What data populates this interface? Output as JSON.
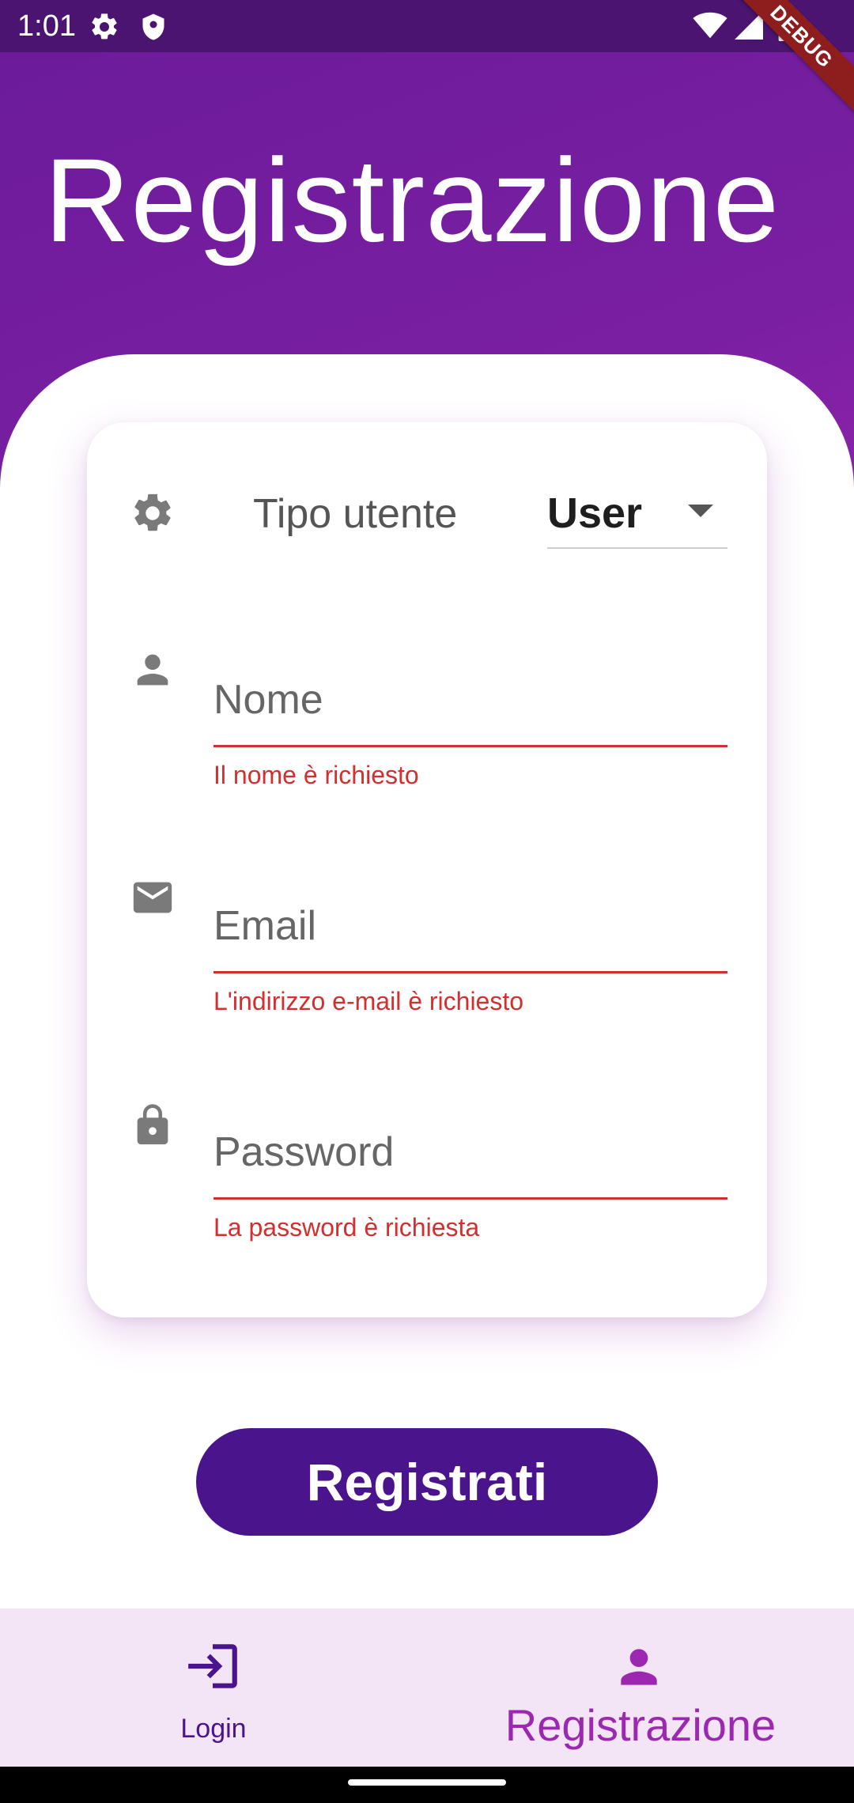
{
  "status_bar": {
    "time": "1:01",
    "icons": [
      "gear-icon",
      "shield-icon",
      "wifi-icon",
      "signal-icon",
      "battery-icon"
    ]
  },
  "debug_banner": "DEBUG",
  "page": {
    "title": "Registrazione"
  },
  "form": {
    "user_type": {
      "label": "Tipo utente",
      "selected": "User",
      "icon": "gear-icon"
    },
    "name": {
      "placeholder": "Nome",
      "value": "",
      "error": "Il nome è richiesto",
      "icon": "person-icon"
    },
    "email": {
      "placeholder": "Email",
      "value": "",
      "error": "L'indirizzo e-mail è richiesto",
      "icon": "mail-icon"
    },
    "password": {
      "placeholder": "Password",
      "value": "",
      "error": "La password è richiesta",
      "icon": "lock-icon"
    }
  },
  "actions": {
    "register_label": "Registrati"
  },
  "bottom_nav": {
    "items": [
      {
        "label": "Login",
        "icon": "login-icon",
        "active": false
      },
      {
        "label": "Registrazione",
        "icon": "person-icon",
        "active": true
      }
    ]
  },
  "colors": {
    "header": "#7b1fa2",
    "status_bar": "#4a1470",
    "primary_button": "#4a148c",
    "error": "#d32f2f",
    "nav_background": "#f3e5f5",
    "nav_active": "#9c27b0",
    "nav_inactive": "#4a148c"
  }
}
